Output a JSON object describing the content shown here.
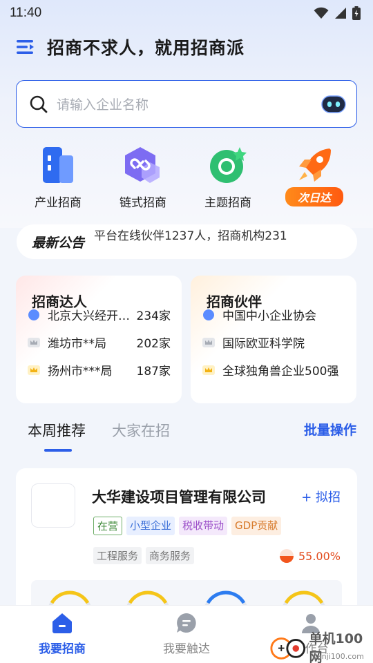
{
  "status_bar": {
    "time": "11:40"
  },
  "header": {
    "title": "招商不求人，就用招商派"
  },
  "search": {
    "placeholder": "请输入企业名称"
  },
  "categories": [
    {
      "label": "产业招商",
      "icon": "building-icon"
    },
    {
      "label": "链式招商",
      "icon": "chain-link-icon"
    },
    {
      "label": "主题招商",
      "icon": "theme-circle-icon"
    },
    {
      "label": "次日达",
      "icon": "rocket-icon"
    }
  ],
  "notice": {
    "brand": "最新公告",
    "message": "平台在线伙伴1237人，招商机构231"
  },
  "panels": {
    "experts": {
      "title": "招商达人",
      "rows": [
        {
          "name": "北京大兴经开…",
          "count": "234家"
        },
        {
          "name": "潍坊市**局",
          "count": "202家"
        },
        {
          "name": "扬州市***局",
          "count": "187家"
        }
      ]
    },
    "partners": {
      "title": "招商伙伴",
      "rows": [
        {
          "name": "中国中小企业协会"
        },
        {
          "name": "国际欧亚科学院"
        },
        {
          "name": "全球独角兽企业500强"
        }
      ]
    }
  },
  "tabs": {
    "active": "本周推荐",
    "inactive": "大家在招",
    "batch": "批量操作"
  },
  "company_card": {
    "name": "大华建设项目管理有限公司",
    "action": "+ 拟招",
    "tags": [
      "在营",
      "小型企业",
      "税收带动",
      "GDP贡献"
    ],
    "service_tags": [
      "工程服务",
      "商务服务"
    ],
    "percent": "55.00%"
  },
  "bottom_nav": [
    {
      "label": "我要招商",
      "icon": "home-icon"
    },
    {
      "label": "我要触达",
      "icon": "chat-icon"
    },
    {
      "label": "工作台",
      "icon": "user-icon"
    }
  ],
  "watermark": {
    "text": "单机100网",
    "sub": "danji100.com"
  },
  "colors": {
    "accent": "#2c5ee8",
    "orange": "#ff6a14",
    "green": "#2fbf71"
  }
}
